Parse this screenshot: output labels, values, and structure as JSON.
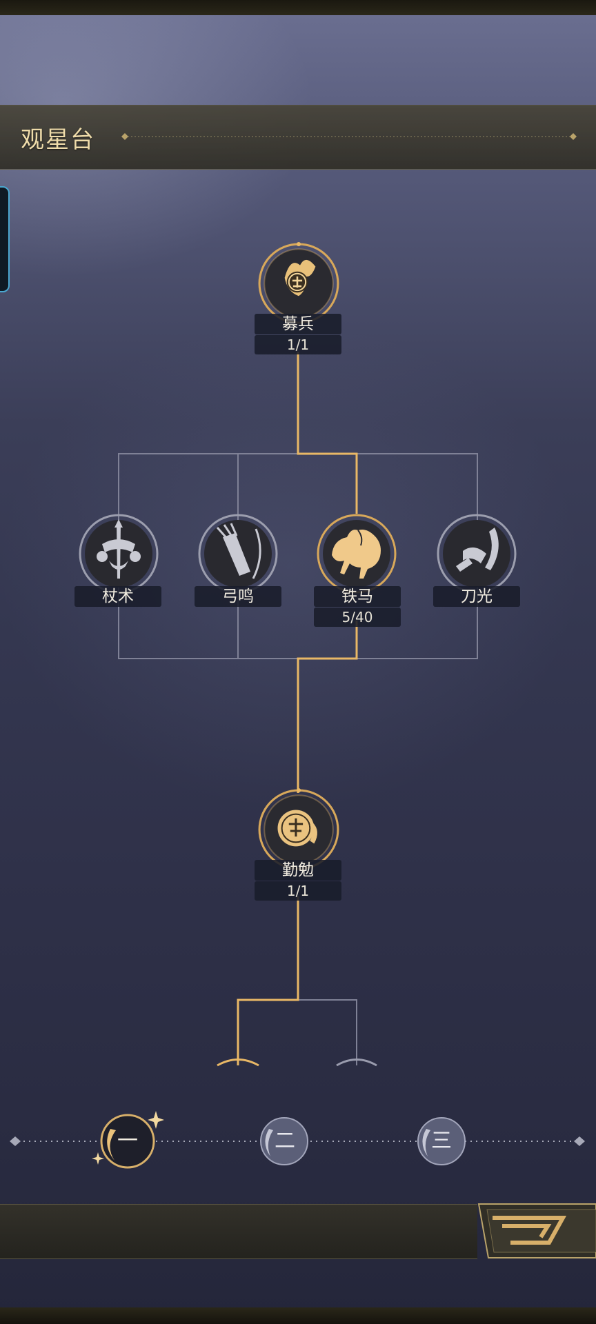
{
  "header": {
    "title": "观星台"
  },
  "talent_tree": {
    "root": {
      "label": "募兵",
      "count": "1/1",
      "icon": "recruit-emblem-icon",
      "state": "active"
    },
    "branches": [
      {
        "label": "杖术",
        "icon": "staff-icon",
        "state": "inactive"
      },
      {
        "label": "弓鸣",
        "icon": "bow-quiver-icon",
        "state": "inactive"
      },
      {
        "label": "铁马",
        "count": "5/40",
        "icon": "horse-icon",
        "state": "active"
      },
      {
        "label": "刀光",
        "icon": "blade-icon",
        "state": "inactive"
      }
    ],
    "middle": {
      "label": "勤勉",
      "count": "1/1",
      "icon": "diligence-emblem-icon",
      "state": "active"
    }
  },
  "tiers": {
    "items": [
      {
        "label": "一",
        "state": "selected"
      },
      {
        "label": "二",
        "state": "normal"
      },
      {
        "label": "三",
        "state": "normal"
      }
    ]
  },
  "footer": {
    "action_icon": "return-arrow-icon"
  },
  "colors": {
    "gold": "#e9b866",
    "gray_line": "#7f8196",
    "title_text": "#efdcaa"
  }
}
